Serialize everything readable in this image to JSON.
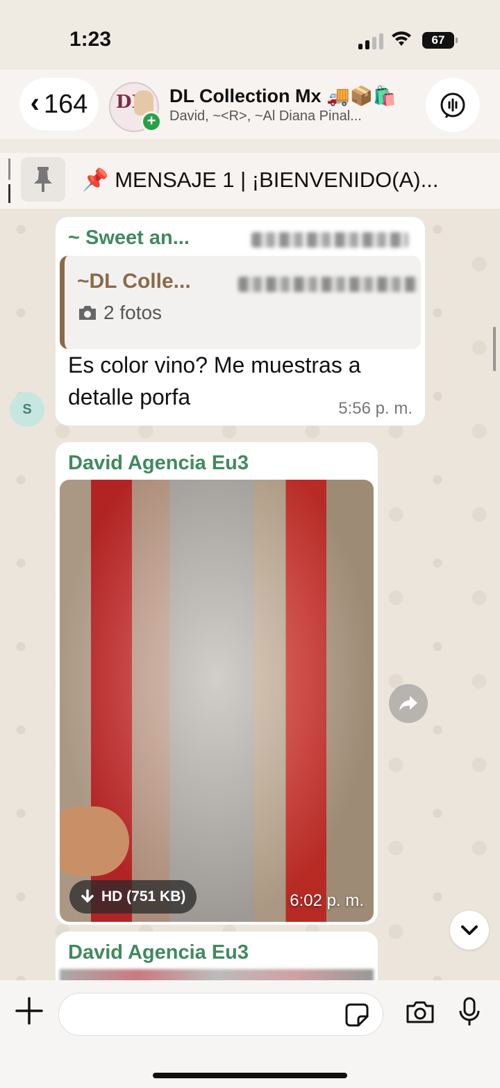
{
  "status_bar": {
    "time": "1:23",
    "battery": "67"
  },
  "header": {
    "back_count": "164",
    "group_name": "DL Collection Mx 🚚📦🛍️",
    "members": "David, ~<R>, ~Al Diana Pinal...",
    "avatar_text": "DL"
  },
  "pinned": {
    "text": "📌 MENSAJE 1 | ¡BIENVENIDO(A)..."
  },
  "messages": [
    {
      "sender": "~ Sweet an...",
      "quote": {
        "sender": "~DL Colle...",
        "media": "2 fotos"
      },
      "text": "Es color vino?  Me muestras a detalle porfa",
      "time": "5:56 p. m.",
      "avatar_initial": "S"
    },
    {
      "sender": "David Agencia Eu3",
      "hd_label": "HD (751 KB)",
      "time": "6:02 p. m."
    },
    {
      "sender": "David Agencia Eu3"
    }
  ],
  "colors": {
    "sender_green": "#3f8a5e",
    "quote_brown": "#8b6a47",
    "badge_green": "#25a244"
  }
}
